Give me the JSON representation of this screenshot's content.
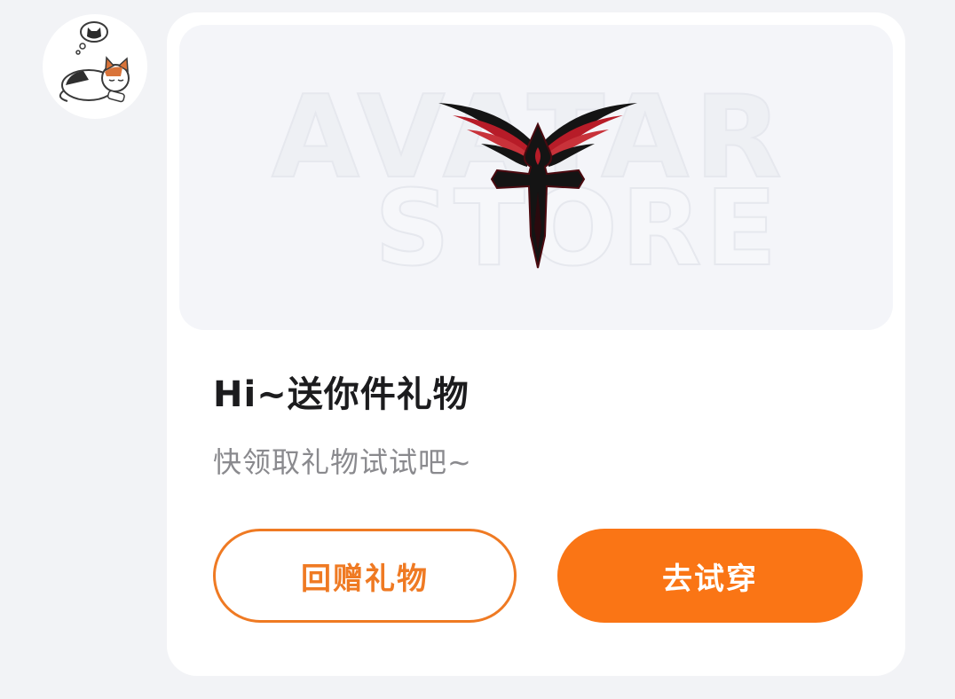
{
  "sender": {
    "avatar_icon": "sleeping-cat-icon"
  },
  "gift_card": {
    "banner": {
      "watermark_line1": "AVATAR",
      "watermark_line2": "STORE",
      "item_icon": "winged-cross-icon",
      "colors": {
        "wing_red": "#b71c28",
        "cross_black": "#141414"
      }
    },
    "title": "Hi~送你件礼物",
    "subtitle": "快领取礼物试试吧~",
    "buttons": {
      "return_gift_label": "回赠礼物",
      "try_on_label": "去试穿"
    },
    "colors": {
      "accent": "#fa7515",
      "outline": "#ef7a23"
    }
  }
}
